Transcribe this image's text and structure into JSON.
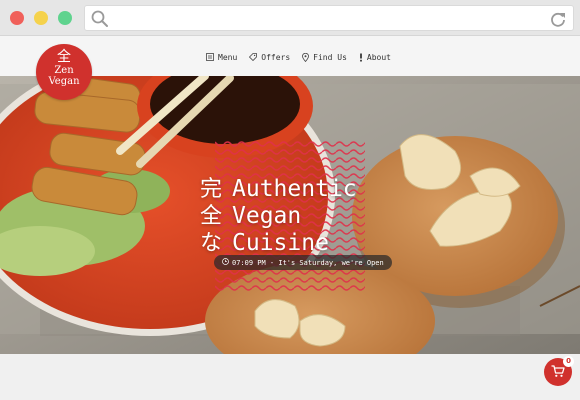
{
  "browser": {
    "url_value": "",
    "colors": {
      "close": "#f0605a",
      "minimize": "#f5d24c",
      "maximize": "#5fd38e"
    }
  },
  "logo": {
    "kanji": "全",
    "line1": "Zen",
    "line2": "Vegan"
  },
  "nav": {
    "items": [
      {
        "label": "Menu",
        "icon": "menu-icon"
      },
      {
        "label": "Offers",
        "icon": "tag-icon"
      },
      {
        "label": "Find Us",
        "icon": "map-pin-icon"
      },
      {
        "label": "About",
        "icon": "info-icon"
      }
    ]
  },
  "hero": {
    "jp": [
      "完",
      "全",
      "な"
    ],
    "en": [
      "Authentic",
      "Vegan",
      "Cuisine"
    ],
    "status": "07:09 PM - It's Saturday, we're Open"
  },
  "cart": {
    "count": "0"
  },
  "colors": {
    "accent": "#d0312d"
  }
}
